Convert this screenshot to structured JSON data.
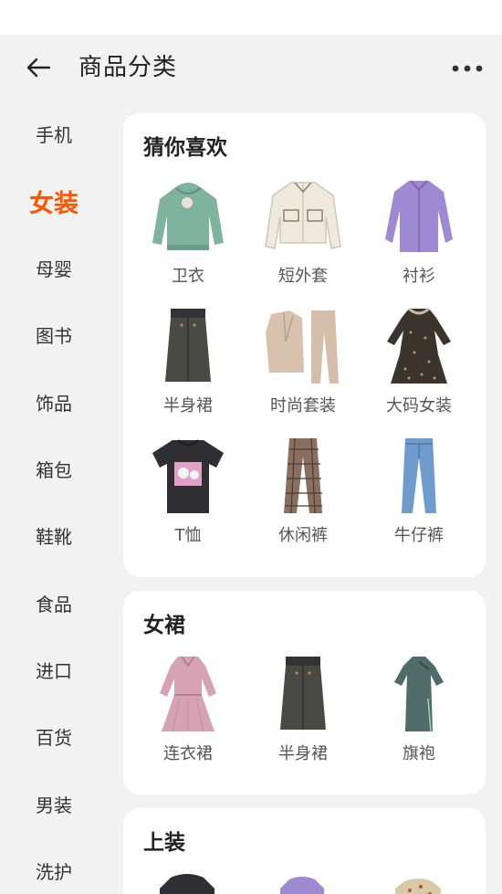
{
  "header": {
    "title": "商品分类"
  },
  "sidebar": {
    "items": [
      {
        "label": "手机"
      },
      {
        "label": "女装"
      },
      {
        "label": "母婴"
      },
      {
        "label": "图书"
      },
      {
        "label": "饰品"
      },
      {
        "label": "箱包"
      },
      {
        "label": "鞋靴"
      },
      {
        "label": "食品"
      },
      {
        "label": "进口"
      },
      {
        "label": "百货"
      },
      {
        "label": "男装"
      },
      {
        "label": "洗护"
      }
    ],
    "active_index": 1
  },
  "sections": [
    {
      "title": "猜你喜欢",
      "items": [
        {
          "label": "卫衣",
          "icon": "hoodie-icon"
        },
        {
          "label": "短外套",
          "icon": "jacket-icon"
        },
        {
          "label": "衬衫",
          "icon": "shirt-icon"
        },
        {
          "label": "半身裙",
          "icon": "skirt-icon"
        },
        {
          "label": "时尚套装",
          "icon": "suit-icon"
        },
        {
          "label": "大码女装",
          "icon": "dress-icon"
        },
        {
          "label": "T恤",
          "icon": "tshirt-icon"
        },
        {
          "label": "休闲裤",
          "icon": "pants-icon"
        },
        {
          "label": "牛仔裤",
          "icon": "jeans-icon"
        }
      ]
    },
    {
      "title": "女裙",
      "items": [
        {
          "label": "连衣裙",
          "icon": "dress-icon"
        },
        {
          "label": "半身裙",
          "icon": "skirt-icon"
        },
        {
          "label": "旗袍",
          "icon": "qipao-icon"
        }
      ]
    },
    {
      "title": "上装",
      "items": []
    }
  ],
  "colors": {
    "accent": "#ff5500",
    "background": "#f2f2f2",
    "card": "#ffffff"
  }
}
